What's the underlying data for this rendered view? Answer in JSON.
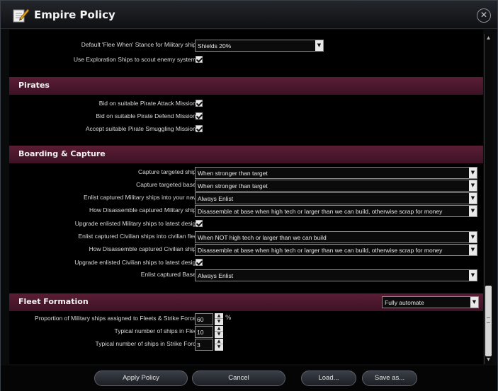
{
  "window": {
    "title": "Empire Policy",
    "close_glyph": "✕"
  },
  "top_rows": {
    "flee_label": "Default 'Flee When' Stance for Military ships",
    "flee_value": "Shields 20%",
    "exploration_label": "Use Exploration Ships to scout enemy systems"
  },
  "pirates": {
    "title": "Pirates",
    "attack_label": "Bid on suitable Pirate Attack Missions",
    "defend_label": "Bid on suitable Pirate Defend Missions",
    "smuggle_label": "Accept suitable Pirate Smuggling Missions"
  },
  "boarding": {
    "title": "Boarding & Capture",
    "rows": [
      {
        "label": "Capture targeted ships",
        "type": "dropdown",
        "value": "When stronger than target"
      },
      {
        "label": "Capture targeted bases",
        "type": "dropdown",
        "value": "When stronger than target"
      },
      {
        "label": "Enlist captured Military ships into your navy",
        "type": "dropdown",
        "value": "Always Enlist"
      },
      {
        "label": "How Disassemble captured Military ships",
        "type": "dropdown",
        "value": "Disassemble at base when high tech or larger than we can build, otherwise scrap for money"
      },
      {
        "label": "Upgrade enlisted Military ships to latest design",
        "type": "checkbox",
        "checked": true
      },
      {
        "label": "Enlist captured Civilian ships into civilian fleet",
        "type": "dropdown",
        "value": "When NOT high tech or larger than we can build"
      },
      {
        "label": "How Disassemble captured Civilian ships",
        "type": "dropdown",
        "value": "Disassemble at base when high tech or larger than we can build, otherwise scrap for money"
      },
      {
        "label": "Upgrade enlisted Civilian ships to latest design",
        "type": "checkbox",
        "checked": true
      },
      {
        "label": "Enlist captured Bases",
        "type": "dropdown",
        "value": "Always Enlist"
      }
    ]
  },
  "fleet": {
    "title": "Fleet Formation",
    "mode_value": "Fully automate",
    "proportion_label": "Proportion of Military ships assigned to Fleets & Strike Forces",
    "proportion_value": "60",
    "proportion_unit": "%",
    "fleet_size_label": "Typical number of ships in Fleet",
    "fleet_size_value": "10",
    "strike_size_label": "Typical number of ships in Strike Force",
    "strike_size_value": "3"
  },
  "footer": {
    "apply": "Apply Policy",
    "cancel": "Cancel",
    "load": "Load...",
    "save": "Save as..."
  },
  "colors": {
    "section_header": "#4e1830",
    "window_bg": "#0a0b0d"
  }
}
